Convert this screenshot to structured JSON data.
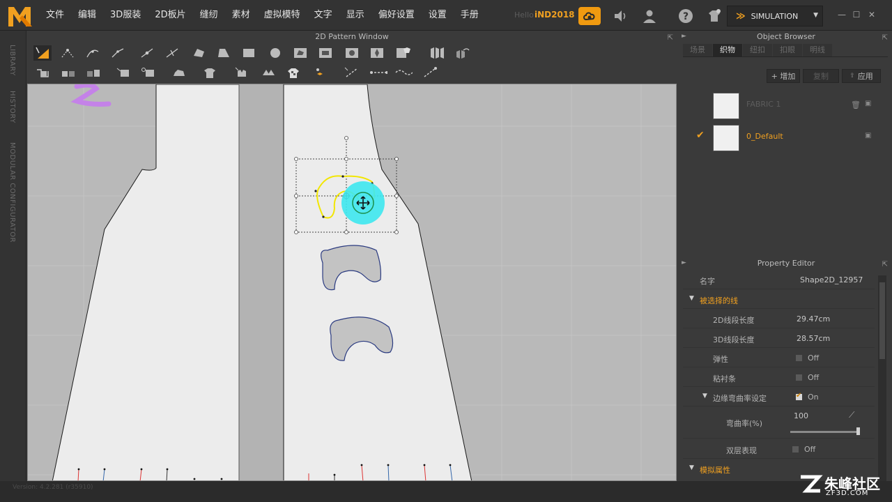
{
  "menu": [
    "文件",
    "编辑",
    "3D服装",
    "2D板片",
    "缝纫",
    "素材",
    "虚拟模特",
    "文字",
    "显示",
    "偏好设置",
    "设置",
    "手册"
  ],
  "user": {
    "hello": "Hello",
    "name": "iND2018"
  },
  "simulation": {
    "label": "SIMULATION"
  },
  "sidebar_tabs": [
    "LIBRARY",
    "HISTORY",
    "MODULAR CONFIGURATOR"
  ],
  "pattern_window": {
    "title": "2D Pattern Window"
  },
  "object_browser": {
    "title": "Object Browser",
    "tabs": [
      "场景",
      "织物",
      "纽扣",
      "扣眼",
      "明线"
    ],
    "active_tab": 1,
    "add_label": "+ 增加",
    "copy_label": "复制",
    "apply_label": "应用",
    "fabrics": [
      {
        "name": "FABRIC 1",
        "selected": false
      },
      {
        "name": "0_Default",
        "selected": true
      }
    ]
  },
  "property_editor": {
    "title": "Property Editor",
    "name_label": "名字",
    "name_value": "Shape2D_12957",
    "section_selected_line": "被选择的线",
    "length_2d_label": "2D线段长度",
    "length_2d_value": "29.47cm",
    "length_3d_label": "3D线段长度",
    "length_3d_value": "28.57cm",
    "elastic_label": "弹性",
    "elastic_value": "Off",
    "interlining_label": "粘衬条",
    "interlining_value": "Off",
    "curvature_section_label": "边缘弯曲率设定",
    "curvature_section_value": "On",
    "curvature_label": "弯曲率(%)",
    "curvature_value": "100",
    "curvature_fraction": 1.0,
    "double_label": "双层表现",
    "double_value": "Off",
    "section_sim": "模拟属性"
  },
  "status": {
    "version": "Version: 4.2.281 (r35910)"
  },
  "watermark": {
    "text": "朱峰社区",
    "url": "ZF3D.COM"
  },
  "colors": {
    "accent": "#f0a020",
    "highlight_yellow": "#f2e600",
    "gizmo_cyan": "#3ee8f0",
    "pattern_fill": "#ececec",
    "canvas_bg": "#b9b9b9"
  }
}
